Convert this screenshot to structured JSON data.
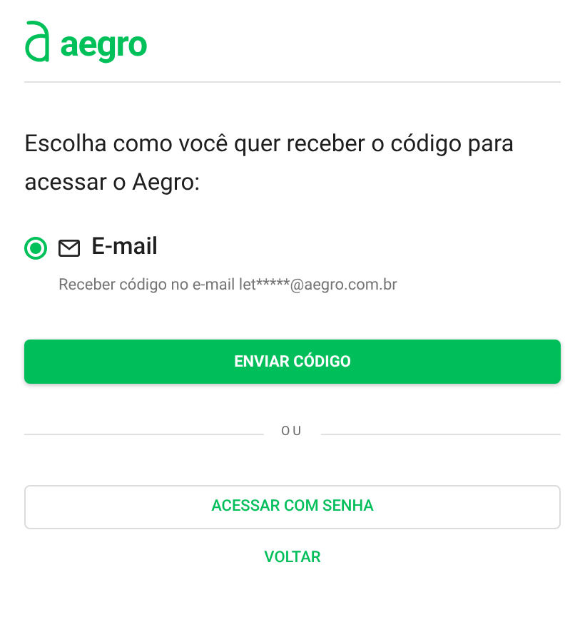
{
  "logo": {
    "text": "aegro"
  },
  "heading": "Escolha como você quer receber o código para acessar o Aegro:",
  "options": [
    {
      "label": "E-mail",
      "description": "Receber código no e-mail let*****@aegro.com.br",
      "selected": true
    }
  ],
  "primary_button": "ENVIAR CÓDIGO",
  "separator": "OU",
  "secondary_button": "ACESSAR COM SENHA",
  "back_link": "VOLTAR"
}
